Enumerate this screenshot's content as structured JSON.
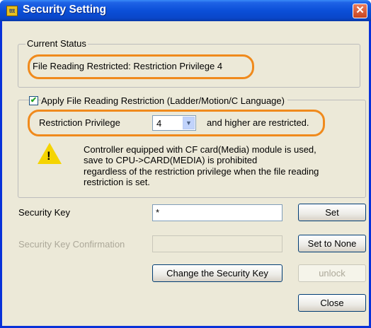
{
  "window": {
    "title": "Security Setting",
    "app_icon_text": "ttt",
    "close_glyph": "✕"
  },
  "current_status": {
    "legend": "Current Status",
    "text": "File Reading Restricted: Restriction Privilege 4"
  },
  "restriction": {
    "checkbox_checked": true,
    "checkbox_label": "Apply File Reading Restriction (Ladder/Motion/C Language)",
    "privilege_label": "Restriction Privilege",
    "privilege_value": "4",
    "privilege_suffix": "and higher are restricted.",
    "warning_icon": "warning-icon",
    "warning_lines": [
      "Controller equipped with CF card(Media) module is used,",
      "save to CPU->CARD(MEDIA) is prohibited",
      "regardless of the restriction privilege when the file reading",
      "restriction is set."
    ]
  },
  "security_key": {
    "label": "Security Key",
    "value": "*"
  },
  "security_key_confirmation": {
    "label": "Security Key Confirmation",
    "value": ""
  },
  "buttons": {
    "set": "Set",
    "set_to_none": "Set to None",
    "change_key": "Change the Security Key",
    "unlock": "unlock",
    "close": "Close"
  },
  "colors": {
    "highlight": "#f08a1c",
    "titlebar": "#0b4fd8"
  }
}
